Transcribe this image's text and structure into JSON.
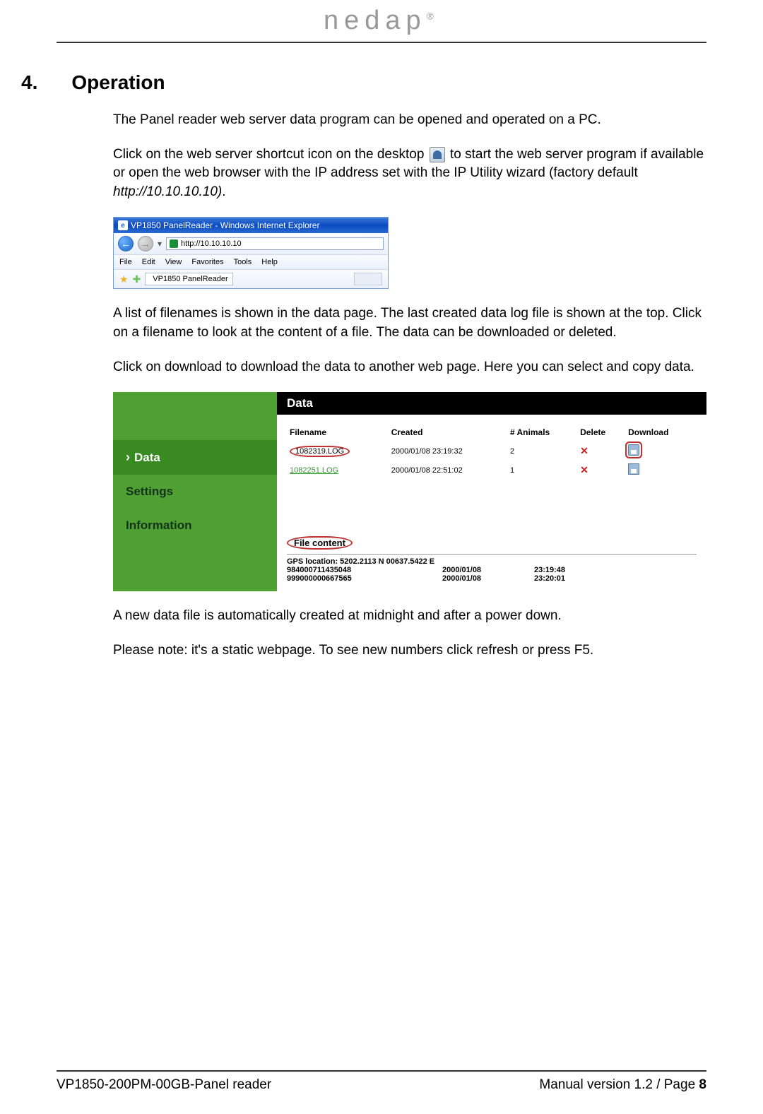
{
  "logo": {
    "text": "nedap",
    "reg": "®"
  },
  "section": {
    "num": "4.",
    "title": "Operation"
  },
  "p1": "The Panel reader web server data program can be opened and operated on a PC.",
  "p2a": "Click on the web server shortcut icon on the desktop ",
  "p2b": " to start the web server program if available or open the web browser with the IP address set with the IP Utility wizard (factory default ",
  "p2c": "http://10.10.10.10)",
  "p2d": ".",
  "ie": {
    "title": "VP1850 PanelReader  - Windows Internet Explorer",
    "url": "http://10.10.10.10",
    "menu": [
      "File",
      "Edit",
      "View",
      "Favorites",
      "Tools",
      "Help"
    ],
    "tab": "VP1850 PanelReader"
  },
  "p3": "A list of filenames is shown in the data page. The last created data log file is shown at the top. Click on a filename to look at the content of a file. The data can be downloaded or deleted.",
  "p4": "Click on download to download the data to another web page. Here you can select and copy data.",
  "panel": {
    "side": {
      "data": "Data",
      "settings": "Settings",
      "information": "Information"
    },
    "header": "Data",
    "cols": {
      "filename": "Filename",
      "created": "Created",
      "animals": "# Animals",
      "delete": "Delete",
      "download": "Download"
    },
    "rows": [
      {
        "filename": "1082319.LOG",
        "created": "2000/01/08 23:19:32",
        "animals": "2"
      },
      {
        "filename": "1082251.LOG",
        "created": "2000/01/08 22:51:02",
        "animals": "1"
      }
    ],
    "fc": {
      "heading": "File content",
      "gps": "GPS location: 5202.2113 N 00637.5422 E",
      "rows": [
        {
          "id": "984000711435048",
          "date": "2000/01/08",
          "time": "23:19:48"
        },
        {
          "id": "999000000667565",
          "date": "2000/01/08",
          "time": "23:20:01"
        }
      ]
    }
  },
  "p5": "A new data file is automatically created at midnight and after a power down.",
  "p6": "Please note: it's a static webpage. To see new numbers click refresh or press F5.",
  "footer": {
    "left": "VP1850-200PM-00GB-Panel reader",
    "right_a": "Manual version 1.2 / Page ",
    "right_b": "8"
  }
}
